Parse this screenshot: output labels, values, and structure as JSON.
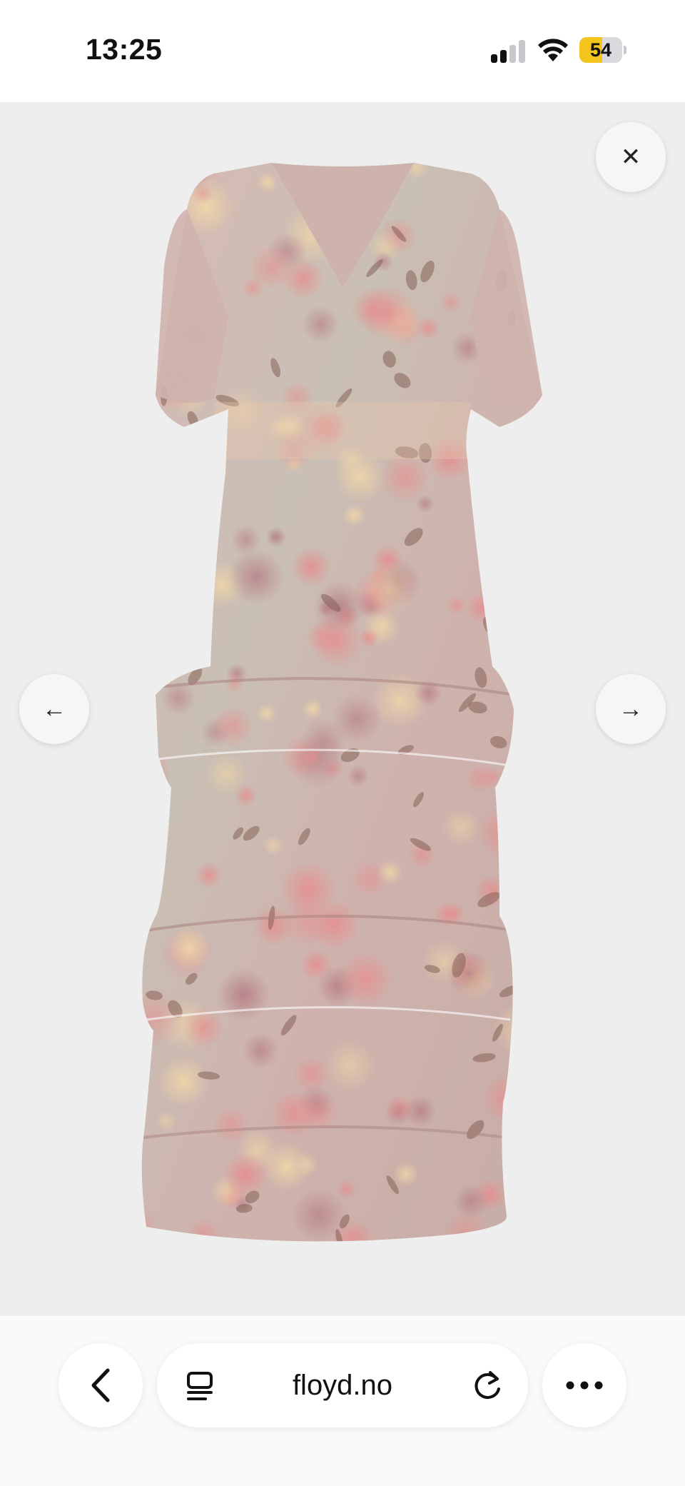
{
  "status_bar": {
    "time": "13:25",
    "battery_level": "54",
    "battery_color": "#f4c51c",
    "signal_bars_active": 2,
    "signal_bars_total": 4
  },
  "viewer": {
    "background": "#eeeeee",
    "product_image": "floral-tiered-maxi-dress",
    "close_icon": "close-icon",
    "close_glyph": "✕",
    "prev_icon": "arrow-left-icon",
    "prev_glyph": "←",
    "next_icon": "arrow-right-icon",
    "next_glyph": "→"
  },
  "browser_bar": {
    "url": "floyd.no",
    "back_icon": "chevron-left-icon",
    "tabs_icon": "tabs-icon",
    "reload_icon": "reload-icon",
    "more_icon": "more-icon"
  }
}
